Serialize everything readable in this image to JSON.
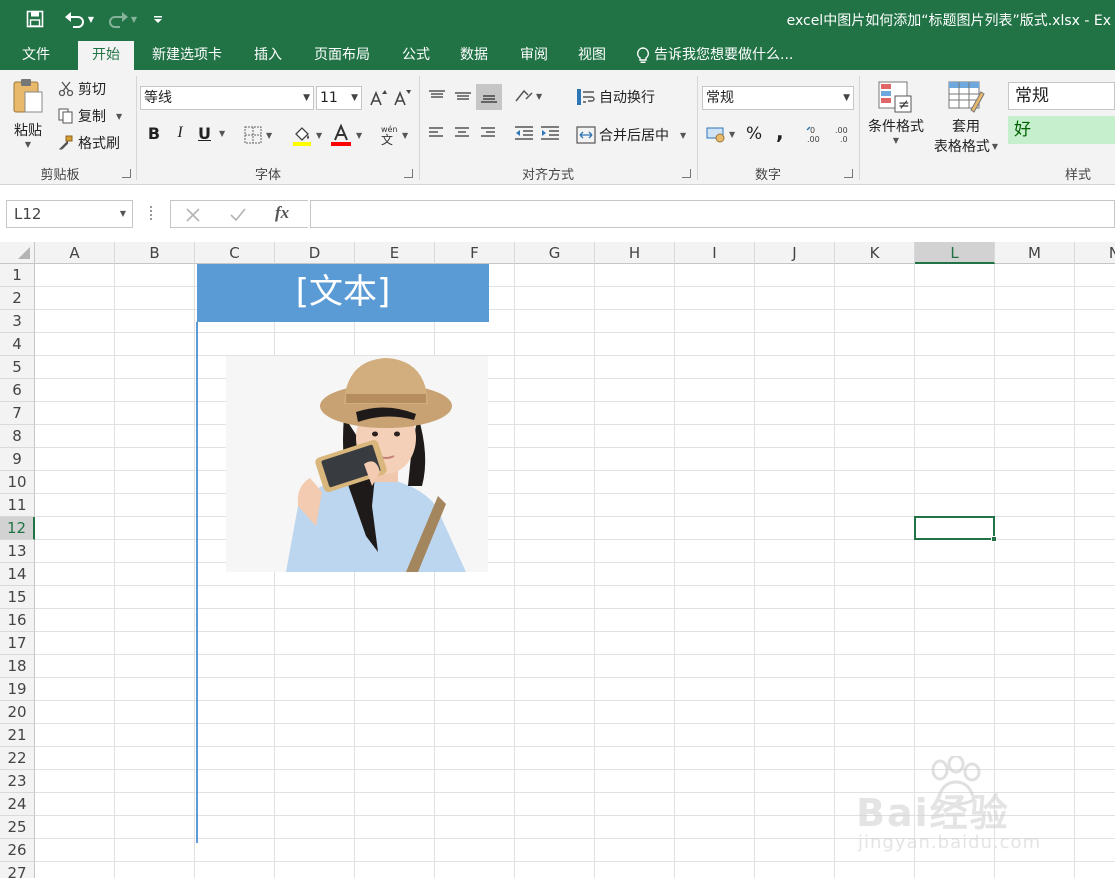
{
  "window": {
    "title": "excel中图片如何添加“标题图片列表”版式.xlsx - Ex"
  },
  "tabs": [
    {
      "label": "文件"
    },
    {
      "label": "开始"
    },
    {
      "label": "新建选项卡"
    },
    {
      "label": "插入"
    },
    {
      "label": "页面布局"
    },
    {
      "label": "公式"
    },
    {
      "label": "数据"
    },
    {
      "label": "审阅"
    },
    {
      "label": "视图"
    }
  ],
  "tell_me": "告诉我您想要做什么...",
  "clipboard": {
    "paste": "粘贴",
    "cut": "剪切",
    "copy": "复制",
    "format_painter": "格式刷",
    "group": "剪贴板"
  },
  "font": {
    "name": "等线",
    "size": "11",
    "bold": "B",
    "italic": "I",
    "underline": "U",
    "group": "字体"
  },
  "alignment": {
    "wrap": "自动换行",
    "merge": "合并后居中",
    "group": "对齐方式"
  },
  "number": {
    "format": "常规",
    "percent": "%",
    "comma": ",",
    "group": "数字"
  },
  "styles": {
    "conditional": "条件格式",
    "table_line1": "套用",
    "table_line2": "表格格式",
    "normal": "常规",
    "good": "好",
    "group": "样式"
  },
  "formula_bar": {
    "name_box": "L12",
    "fx": "fx"
  },
  "sheet": {
    "columns": [
      "A",
      "B",
      "C",
      "D",
      "E",
      "F",
      "G",
      "H",
      "I",
      "J",
      "K",
      "L",
      "M",
      "N"
    ],
    "rows": [
      "1",
      "2",
      "3",
      "4",
      "5",
      "6",
      "7",
      "8",
      "9",
      "10",
      "11",
      "12",
      "13",
      "14",
      "15",
      "16",
      "17",
      "18",
      "19",
      "20",
      "21",
      "22",
      "23",
      "24",
      "25",
      "26",
      "27"
    ],
    "title_text": "[文本]",
    "selected_cell": "L12"
  },
  "watermark": {
    "brand": "Bai经验",
    "url": "jingyan.baidu.com"
  },
  "colors": {
    "excel_green": "#217346",
    "title_blue": "#5b9bd5",
    "good_fill": "#c6efce",
    "good_text": "#006100"
  }
}
